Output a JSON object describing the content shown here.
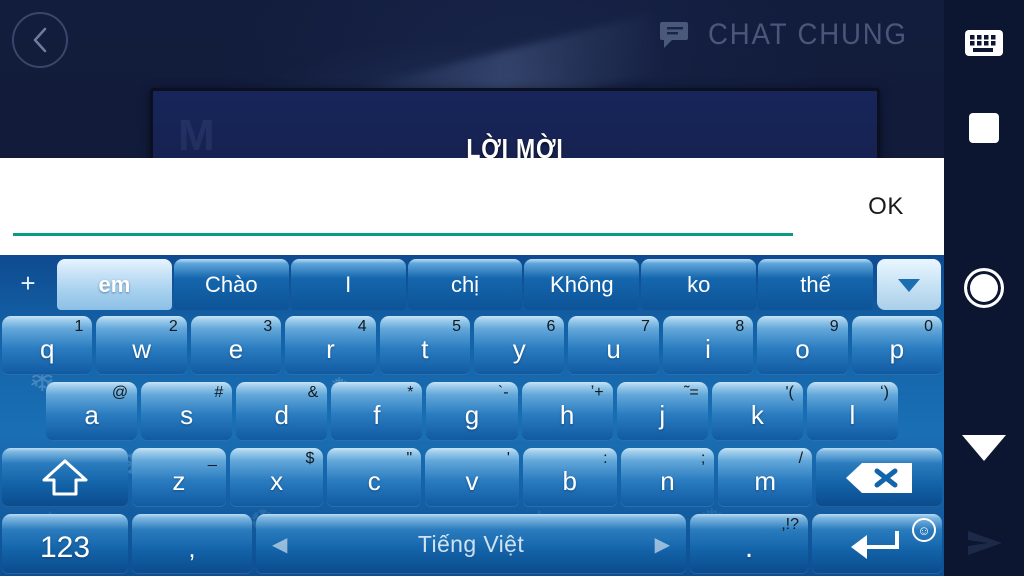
{
  "game": {
    "back_label": "back",
    "chat_tab_label": "CHAT CHUNG",
    "panel_title": "LỜI MỜI",
    "panel_faint_letter": "M"
  },
  "input_dialog": {
    "field_value": "",
    "field_placeholder": "",
    "ok_label": "OK",
    "accent_color": "#089b85"
  },
  "keyboard": {
    "add_label": "+",
    "suggestions": [
      {
        "label": "em",
        "selected": true
      },
      {
        "label": "Chào",
        "selected": false
      },
      {
        "label": "I",
        "selected": false
      },
      {
        "label": "chị",
        "selected": false
      },
      {
        "label": "Không",
        "selected": false
      },
      {
        "label": "ko",
        "selected": false
      },
      {
        "label": "thế",
        "selected": false
      }
    ],
    "expand_label": "▼",
    "row1": [
      {
        "main": "q",
        "alt": "1"
      },
      {
        "main": "w",
        "alt": "2"
      },
      {
        "main": "e",
        "alt": "3"
      },
      {
        "main": "r",
        "alt": "4"
      },
      {
        "main": "t",
        "alt": "5"
      },
      {
        "main": "y",
        "alt": "6"
      },
      {
        "main": "u",
        "alt": "7"
      },
      {
        "main": "i",
        "alt": "8"
      },
      {
        "main": "o",
        "alt": "9"
      },
      {
        "main": "p",
        "alt": "0"
      }
    ],
    "row2": [
      {
        "main": "a",
        "alt": "@"
      },
      {
        "main": "s",
        "alt": "#"
      },
      {
        "main": "d",
        "alt": "&"
      },
      {
        "main": "f",
        "alt": "*"
      },
      {
        "main": "g",
        "alt": "`-"
      },
      {
        "main": "h",
        "alt": "ʼ+"
      },
      {
        "main": "j",
        "alt": "˜="
      },
      {
        "main": "k",
        "alt": "ʹ("
      },
      {
        "main": "l",
        "alt": "ʻ)"
      }
    ],
    "row3": [
      {
        "main": "z",
        "alt": "_"
      },
      {
        "main": "x",
        "alt": "$"
      },
      {
        "main": "c",
        "alt": "\""
      },
      {
        "main": "v",
        "alt": "'"
      },
      {
        "main": "b",
        "alt": ":"
      },
      {
        "main": "n",
        "alt": ";"
      },
      {
        "main": "m",
        "alt": "/"
      }
    ],
    "shift_label": "shift",
    "backspace_label": "backspace",
    "numbers_label": "123",
    "comma_label": ",",
    "space_label": "Tiếng Việt",
    "space_prev": "◀",
    "space_next": "▶",
    "period_main": ".",
    "period_alt": ",!?",
    "enter_label": "enter",
    "emoji_label": "☺"
  },
  "navbar": {
    "keyboard_label": "keyboard",
    "recents_label": "recents",
    "home_label": "home",
    "hide_keyboard_label": "hide keyboard",
    "send_label": "send"
  }
}
